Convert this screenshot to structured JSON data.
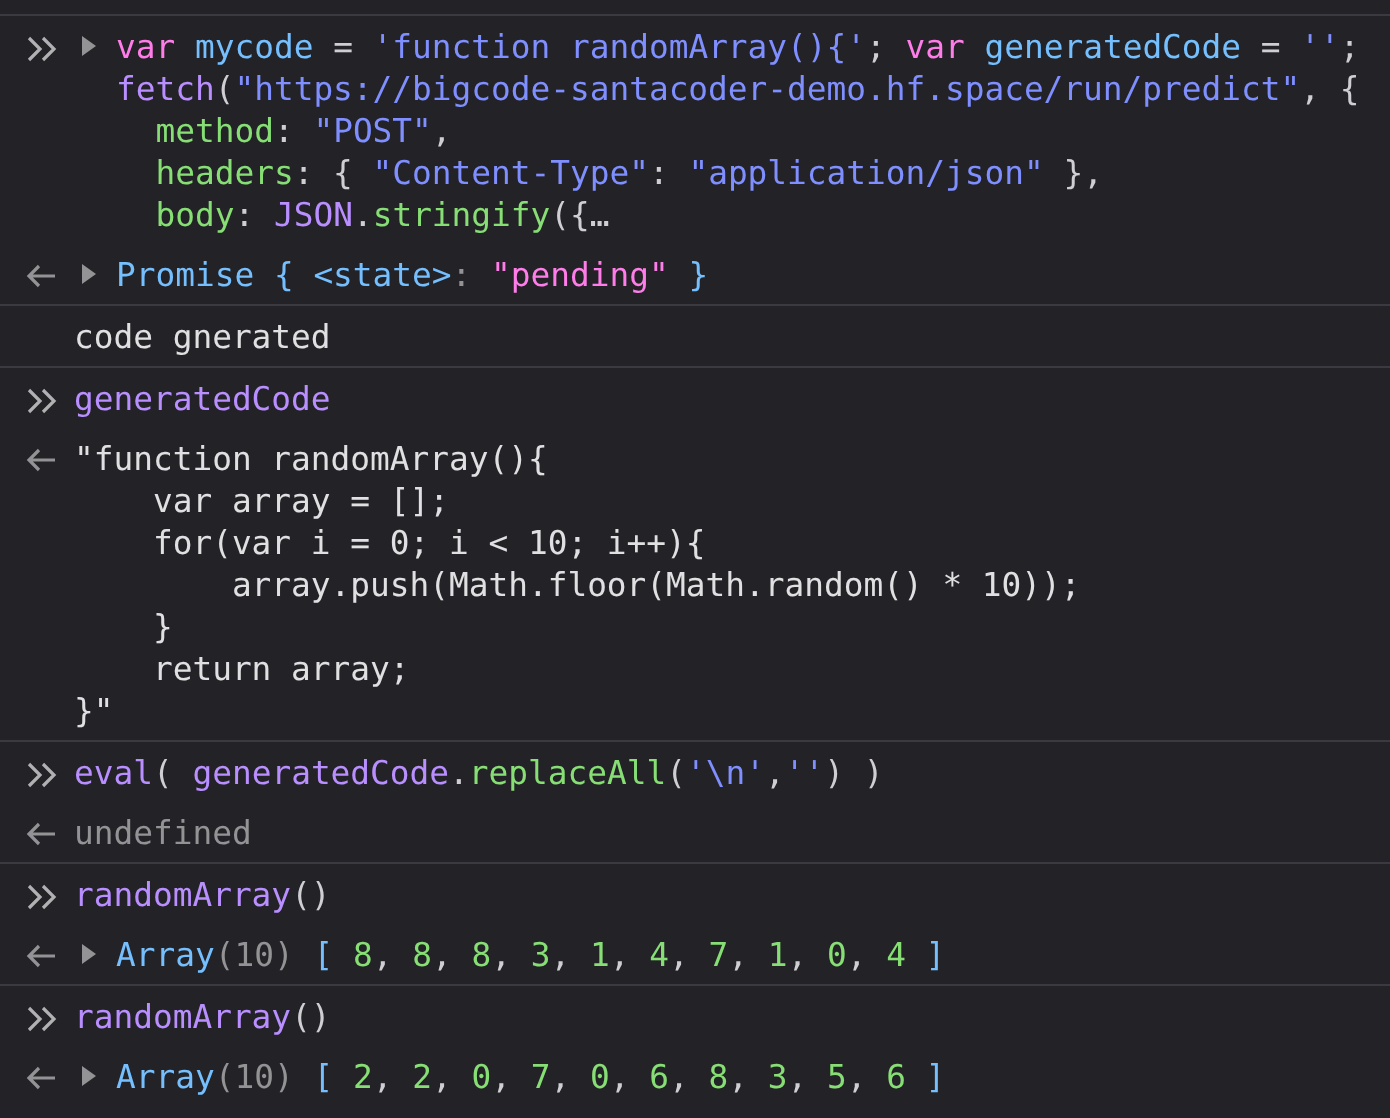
{
  "console": {
    "entries": [
      {
        "kind": "input",
        "expanded": false,
        "lines": [
          [
            {
              "text": "var ",
              "kind": "keyword"
            },
            {
              "text": "mycode",
              "kind": "variable"
            },
            {
              "text": " = ",
              "kind": "punct"
            },
            {
              "text": "'function randomArray(){'",
              "kind": "string"
            },
            {
              "text": "; ",
              "kind": "punct"
            },
            {
              "text": "var ",
              "kind": "keyword"
            },
            {
              "text": "generatedCode",
              "kind": "variable"
            },
            {
              "text": " = ",
              "kind": "punct"
            },
            {
              "text": "''",
              "kind": "string"
            },
            {
              "text": ";",
              "kind": "punct"
            }
          ],
          [
            {
              "text": "fetch",
              "kind": "call"
            },
            {
              "text": "(",
              "kind": "punct"
            },
            {
              "text": "\"https://bigcode-santacoder-demo.hf.space/run/predict\"",
              "kind": "string"
            },
            {
              "text": ", {",
              "kind": "punct"
            }
          ],
          [
            {
              "text": "  method",
              "kind": "property"
            },
            {
              "text": ": ",
              "kind": "punct"
            },
            {
              "text": "\"POST\"",
              "kind": "string"
            },
            {
              "text": ",",
              "kind": "punct"
            }
          ],
          [
            {
              "text": "  headers",
              "kind": "property"
            },
            {
              "text": ": { ",
              "kind": "punct"
            },
            {
              "text": "\"Content-Type\"",
              "kind": "string"
            },
            {
              "text": ": ",
              "kind": "punct"
            },
            {
              "text": "\"application/json\"",
              "kind": "string"
            },
            {
              "text": " },",
              "kind": "punct"
            }
          ],
          [
            {
              "text": "  body",
              "kind": "property"
            },
            {
              "text": ": ",
              "kind": "punct"
            },
            {
              "text": "JSON",
              "kind": "call"
            },
            {
              "text": ".",
              "kind": "punct"
            },
            {
              "text": "stringify",
              "kind": "property"
            },
            {
              "text": "({…",
              "kind": "punct"
            }
          ]
        ]
      },
      {
        "kind": "output",
        "expanded": false,
        "lines": [
          [
            {
              "text": "Promise { ",
              "kind": "type"
            },
            {
              "text": "<state>",
              "kind": "type"
            },
            {
              "text": ": ",
              "kind": "muted"
            },
            {
              "text": "\"pending\"",
              "kind": "state"
            },
            {
              "text": " }",
              "kind": "type"
            }
          ]
        ]
      },
      {
        "kind": "log",
        "lines": [
          [
            {
              "text": "code gnerated",
              "kind": "plain"
            }
          ]
        ]
      },
      {
        "kind": "input",
        "lines": [
          [
            {
              "text": "generatedCode",
              "kind": "call"
            }
          ]
        ]
      },
      {
        "kind": "output",
        "lines": [
          [
            {
              "text": "\"function randomArray(){",
              "kind": "plain"
            }
          ],
          [
            {
              "text": "    var array = [];",
              "kind": "plain"
            }
          ],
          [
            {
              "text": "    for(var i = 0; i < 10; i++){",
              "kind": "plain"
            }
          ],
          [
            {
              "text": "        array.push(Math.floor(Math.random() * 10));",
              "kind": "plain"
            }
          ],
          [
            {
              "text": "    }",
              "kind": "plain"
            }
          ],
          [
            {
              "text": "    return array;",
              "kind": "plain"
            }
          ],
          [
            {
              "text": "}\"",
              "kind": "plain"
            }
          ]
        ]
      },
      {
        "kind": "input",
        "lines": [
          [
            {
              "text": "eval",
              "kind": "call"
            },
            {
              "text": "( ",
              "kind": "punct"
            },
            {
              "text": "generatedCode",
              "kind": "call"
            },
            {
              "text": ".",
              "kind": "punct"
            },
            {
              "text": "replaceAll",
              "kind": "property"
            },
            {
              "text": "(",
              "kind": "punct"
            },
            {
              "text": "'\\n'",
              "kind": "string"
            },
            {
              "text": ",",
              "kind": "punct"
            },
            {
              "text": "''",
              "kind": "string"
            },
            {
              "text": ") )",
              "kind": "punct"
            }
          ]
        ]
      },
      {
        "kind": "output",
        "lines": [
          [
            {
              "text": "undefined",
              "kind": "muted"
            }
          ]
        ]
      },
      {
        "kind": "input",
        "lines": [
          [
            {
              "text": "randomArray",
              "kind": "call"
            },
            {
              "text": "()",
              "kind": "punct"
            }
          ]
        ]
      },
      {
        "kind": "output",
        "expanded": false,
        "lines": [
          [
            {
              "text": "Array",
              "kind": "type"
            },
            {
              "text": "(10)",
              "kind": "muted"
            },
            {
              "text": " [ ",
              "kind": "type"
            },
            {
              "text": "8",
              "kind": "number"
            },
            {
              "text": ", ",
              "kind": "punct"
            },
            {
              "text": "8",
              "kind": "number"
            },
            {
              "text": ", ",
              "kind": "punct"
            },
            {
              "text": "8",
              "kind": "number"
            },
            {
              "text": ", ",
              "kind": "punct"
            },
            {
              "text": "3",
              "kind": "number"
            },
            {
              "text": ", ",
              "kind": "punct"
            },
            {
              "text": "1",
              "kind": "number"
            },
            {
              "text": ", ",
              "kind": "punct"
            },
            {
              "text": "4",
              "kind": "number"
            },
            {
              "text": ", ",
              "kind": "punct"
            },
            {
              "text": "7",
              "kind": "number"
            },
            {
              "text": ", ",
              "kind": "punct"
            },
            {
              "text": "1",
              "kind": "number"
            },
            {
              "text": ", ",
              "kind": "punct"
            },
            {
              "text": "0",
              "kind": "number"
            },
            {
              "text": ", ",
              "kind": "punct"
            },
            {
              "text": "4",
              "kind": "number"
            },
            {
              "text": " ]",
              "kind": "type"
            }
          ]
        ]
      },
      {
        "kind": "input",
        "lines": [
          [
            {
              "text": "randomArray",
              "kind": "call"
            },
            {
              "text": "()",
              "kind": "punct"
            }
          ]
        ]
      },
      {
        "kind": "output",
        "expanded": false,
        "lines": [
          [
            {
              "text": "Array",
              "kind": "type"
            },
            {
              "text": "(10)",
              "kind": "muted"
            },
            {
              "text": " [ ",
              "kind": "type"
            },
            {
              "text": "2",
              "kind": "number"
            },
            {
              "text": ", ",
              "kind": "punct"
            },
            {
              "text": "2",
              "kind": "number"
            },
            {
              "text": ", ",
              "kind": "punct"
            },
            {
              "text": "0",
              "kind": "number"
            },
            {
              "text": ", ",
              "kind": "punct"
            },
            {
              "text": "7",
              "kind": "number"
            },
            {
              "text": ", ",
              "kind": "punct"
            },
            {
              "text": "0",
              "kind": "number"
            },
            {
              "text": ", ",
              "kind": "punct"
            },
            {
              "text": "6",
              "kind": "number"
            },
            {
              "text": ", ",
              "kind": "punct"
            },
            {
              "text": "8",
              "kind": "number"
            },
            {
              "text": ", ",
              "kind": "punct"
            },
            {
              "text": "3",
              "kind": "number"
            },
            {
              "text": ", ",
              "kind": "punct"
            },
            {
              "text": "5",
              "kind": "number"
            },
            {
              "text": ", ",
              "kind": "punct"
            },
            {
              "text": "6",
              "kind": "number"
            },
            {
              "text": " ]",
              "kind": "type"
            }
          ]
        ]
      }
    ]
  }
}
